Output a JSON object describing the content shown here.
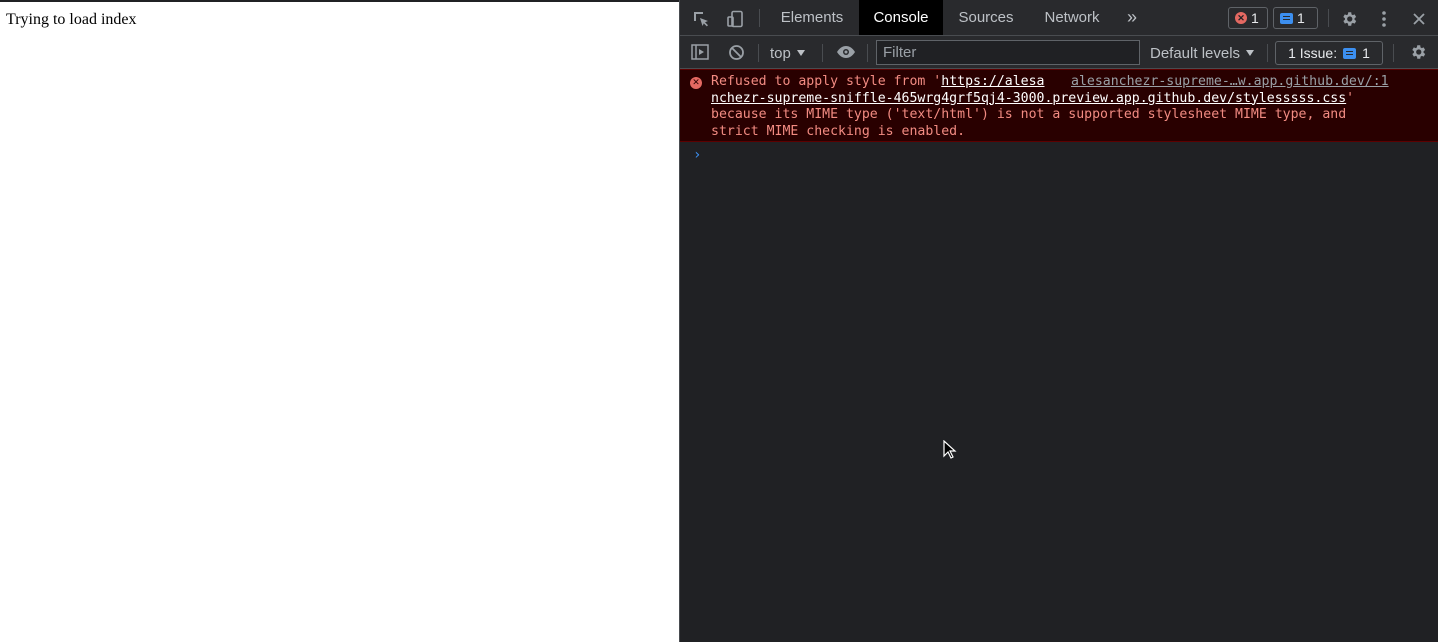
{
  "page": {
    "text": "Trying to load index"
  },
  "devtools": {
    "tabs": [
      {
        "label": "Elements",
        "active": false
      },
      {
        "label": "Console",
        "active": true
      },
      {
        "label": "Sources",
        "active": false
      },
      {
        "label": "Network",
        "active": false
      }
    ],
    "more_tabs_glyph": "»",
    "error_count": "1",
    "message_count": "1",
    "icons": {
      "inspect": "inspect-element-icon",
      "device": "device-toolbar-icon",
      "settings": "gear-icon",
      "menu": "kebab-menu-icon",
      "close": "close-icon"
    }
  },
  "console_toolbar": {
    "context": "top",
    "filter_placeholder": "Filter",
    "levels": "Default levels",
    "issues_label": "1 Issue:",
    "issues_count": "1"
  },
  "console": {
    "error": {
      "prefix": "Refused to apply style from '",
      "url_part1": "https://alesa",
      "url_part2": "nchezr-supreme-sniffle-465wrg4grf5qj4-3000.preview.app.github.dev/stylesssss.css",
      "quote": "'",
      "line3": "because its MIME type ('text/html') is not a supported stylesheet MIME type, and",
      "line4": "strict MIME checking is enabled.",
      "source": "alesanchezr-supreme-…w.app.github.dev/:1"
    },
    "prompt": "›"
  },
  "colors": {
    "devtools_bg": "#202124",
    "toolbar_bg": "#292a2d",
    "error_bg": "#290000",
    "error_text": "#f28b82",
    "accent": "#3c8ff0"
  }
}
